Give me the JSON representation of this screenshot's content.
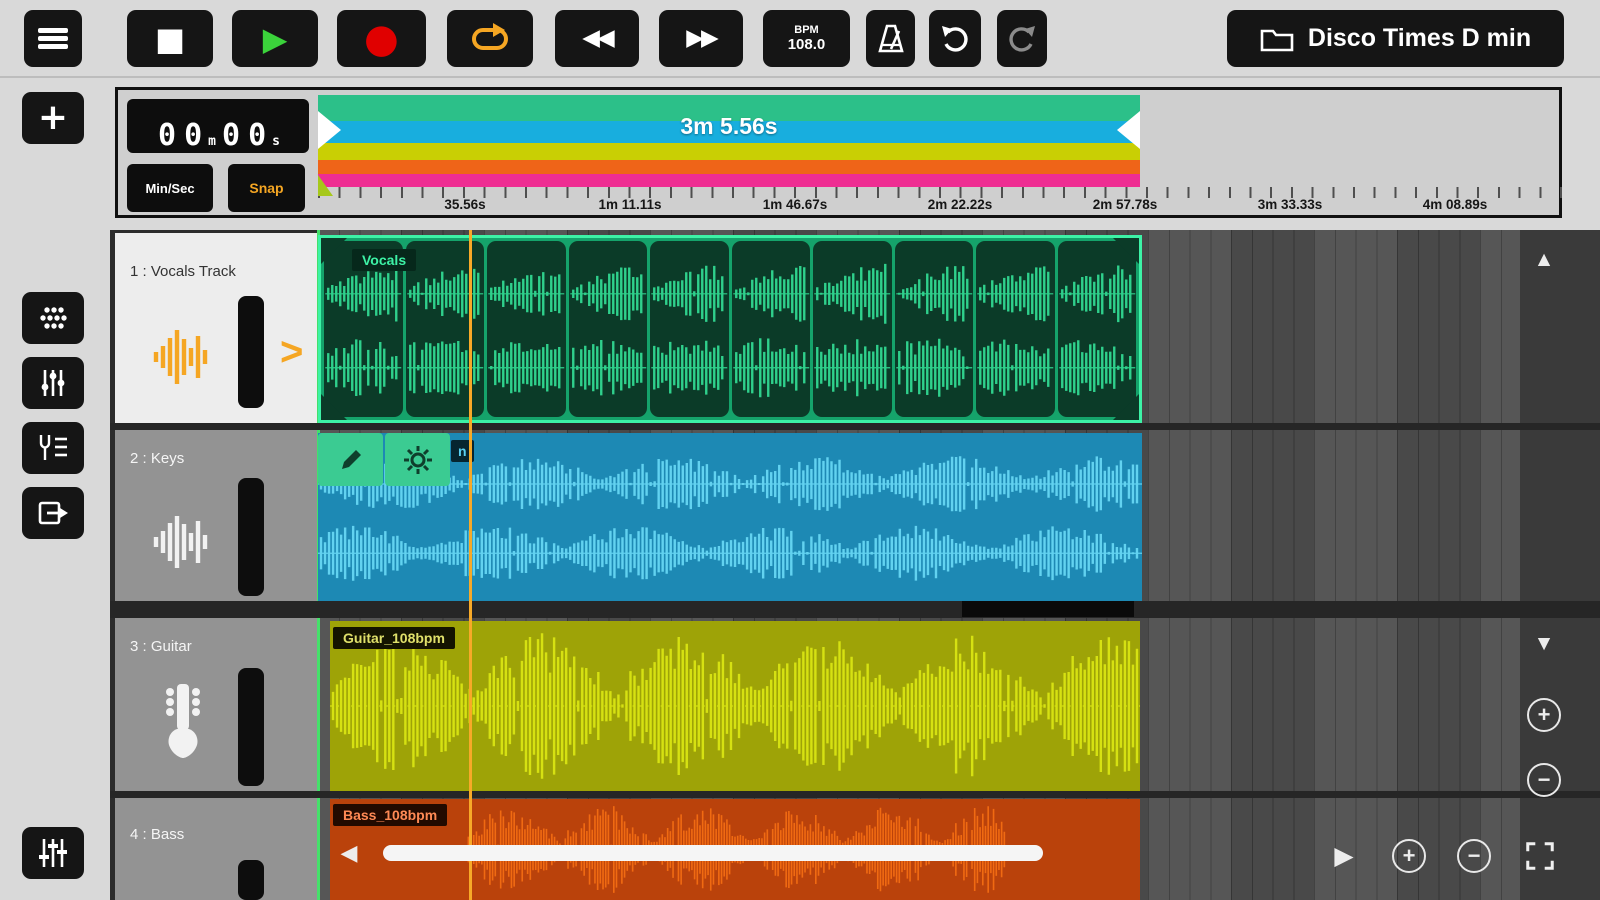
{
  "colors": {
    "accent_orange": "#f5a623",
    "play_green": "#3bd33b",
    "record_red": "#e00000",
    "stripe_green": "#2cc089",
    "stripe_cyan": "#18aede",
    "stripe_yellow": "#c9cf04",
    "stripe_orange": "#ef6418",
    "stripe_magenta": "#ee2d92",
    "vocals_clip": "#15a36b",
    "keys_clip": "#1d89b4",
    "guitar_clip": "#9ea307",
    "bass_clip": "#ba420b"
  },
  "icons": {
    "stop": "■",
    "play": "▶",
    "record": "●",
    "rewind": "◀◀",
    "forward": "▶▶",
    "scroll_up": "▲",
    "scroll_down": "▼",
    "scroll_left": "◀",
    "mini_play": "▶",
    "zoom_in": "+",
    "zoom_out": "−",
    "expand": ">",
    "plus": "+"
  },
  "toolbar": {
    "bpm_label": "BPM",
    "bpm_value": "108.0",
    "project_name": "Disco Times D min"
  },
  "time_display": {
    "m_tens": "0",
    "m_ones": "0",
    "m_unit": "m",
    "s_tens": "0",
    "s_ones": "0",
    "s_unit": "s"
  },
  "controls": {
    "min_sec": "Min/Sec",
    "snap": "Snap"
  },
  "timeline": {
    "selection_length": "3m 5.56s",
    "ticks": [
      "35.56s",
      "1m 11.11s",
      "1m 46.67s",
      "2m 22.22s",
      "2m 57.78s",
      "3m 33.33s",
      "4m 08.89s"
    ]
  },
  "tracks": [
    {
      "name": "1 : Vocals Track",
      "clip_label": "Vocals"
    },
    {
      "name": "2 : Keys",
      "clip_label": "n"
    },
    {
      "name": "3 : Guitar",
      "clip_label": "Guitar_108bpm"
    },
    {
      "name": "4 : Bass",
      "clip_label": "Bass_108bpm"
    }
  ]
}
